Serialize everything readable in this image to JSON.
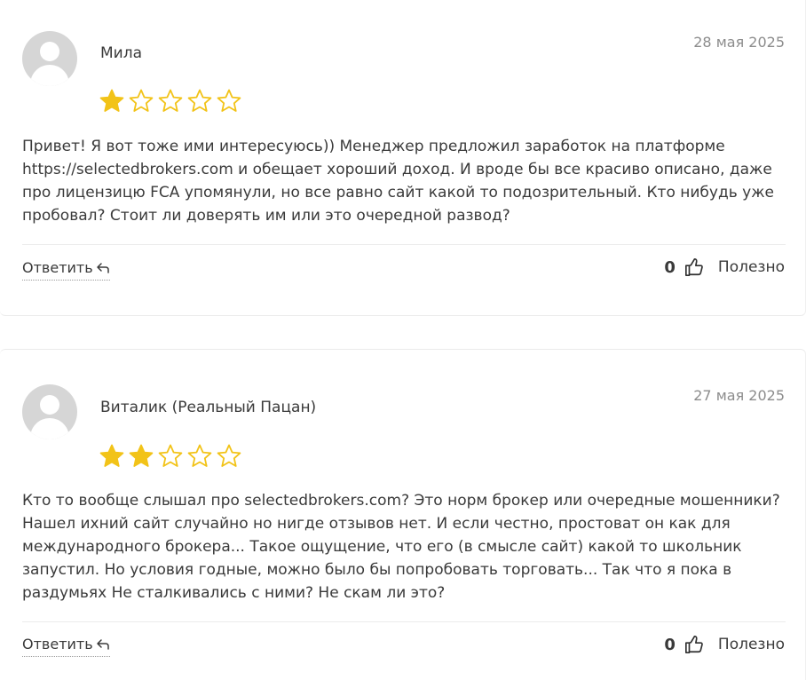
{
  "reviews": [
    {
      "author": "Мила",
      "date": "28 мая 2025",
      "rating": 1,
      "max_rating": 5,
      "text": "Привет! Я вот тоже ими интересуюсь)) Менеджер предложил заработок на платформе https://selectedbrokers.com и обещает хороший доход. И вроде бы все красиво описано, даже про лицензицю FCA упомянули, но все равно сайт какой то подозрительный. Кто нибудь уже пробовал? Стоит ли доверять им или это очередной развод?",
      "reply_label": "Ответить",
      "helpful_count": "0",
      "helpful_label": "Полезно"
    },
    {
      "author": "Виталик (Реальный Пацан)",
      "date": "27 мая 2025",
      "rating": 2,
      "max_rating": 5,
      "text": "Кто то вообще слышал про selectedbrokers.com? Это норм брокер или очередные мошенники? Нашел ихний сайт случайно но нигде отзывов нет. И если честно, простоват он как для международного брокера... Такое ощущение, что его (в смысле сайт) какой то школьник запустил. Но условия годные, можно было бы попробовать торговать... Так что я пока в раздумьях Не сталкивались с ними? Не скам ли это?",
      "reply_label": "Ответить",
      "helpful_count": "0",
      "helpful_label": "Полезно"
    }
  ],
  "colors": {
    "star_filled": "#f2c318",
    "star_empty_stroke": "#f2c318"
  },
  "icons": {
    "reply": "reply-arrow-icon",
    "helpful": "thumbs-up-icon",
    "avatar": "user-placeholder-avatar",
    "star": "star-icon"
  }
}
